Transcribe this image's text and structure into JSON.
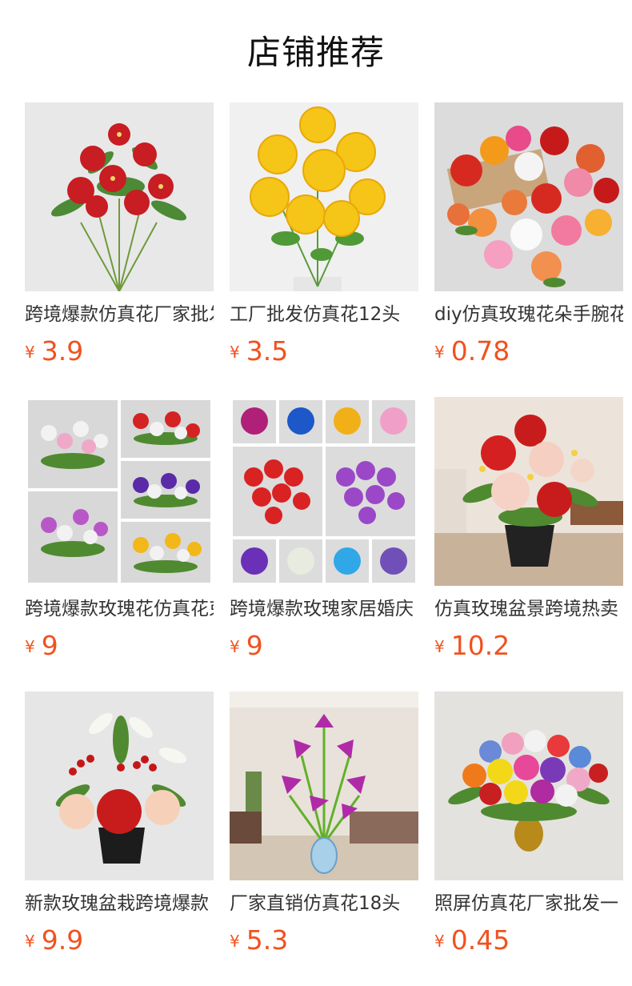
{
  "header": {
    "title": "店铺推荐"
  },
  "currency_symbol": "¥",
  "colors": {
    "price": "#f0521f",
    "title": "#111111",
    "text": "#333333"
  },
  "products": [
    {
      "name": "跨境爆款仿真花厂家批发",
      "price": "3.9",
      "image_icon": "red-lily-bouquet-image"
    },
    {
      "name": "工厂批发仿真花12头",
      "price": "3.5",
      "image_icon": "yellow-carnation-bouquet-image"
    },
    {
      "name": "diy仿真玫瑰花朵手腕花",
      "price": "0.78",
      "image_icon": "rose-heads-image"
    },
    {
      "name": "跨境爆款玫瑰花仿真花束",
      "price": "9",
      "image_icon": "rose-bouquet-collage-image"
    },
    {
      "name": "跨境爆款玫瑰家居婚庆",
      "price": "9",
      "image_icon": "rose-variety-grid-image"
    },
    {
      "name": "仿真玫瑰盆景跨境热卖",
      "price": "10.2",
      "image_icon": "potted-rose-image"
    },
    {
      "name": "新款玫瑰盆栽跨境爆款",
      "price": "9.9",
      "image_icon": "rose-lily-pot-image"
    },
    {
      "name": "厂家直销仿真花18头",
      "price": "5.3",
      "image_icon": "purple-calla-vase-image"
    },
    {
      "name": "照屏仿真花厂家批发一",
      "price": "0.45",
      "image_icon": "colorful-rose-vase-image"
    }
  ]
}
